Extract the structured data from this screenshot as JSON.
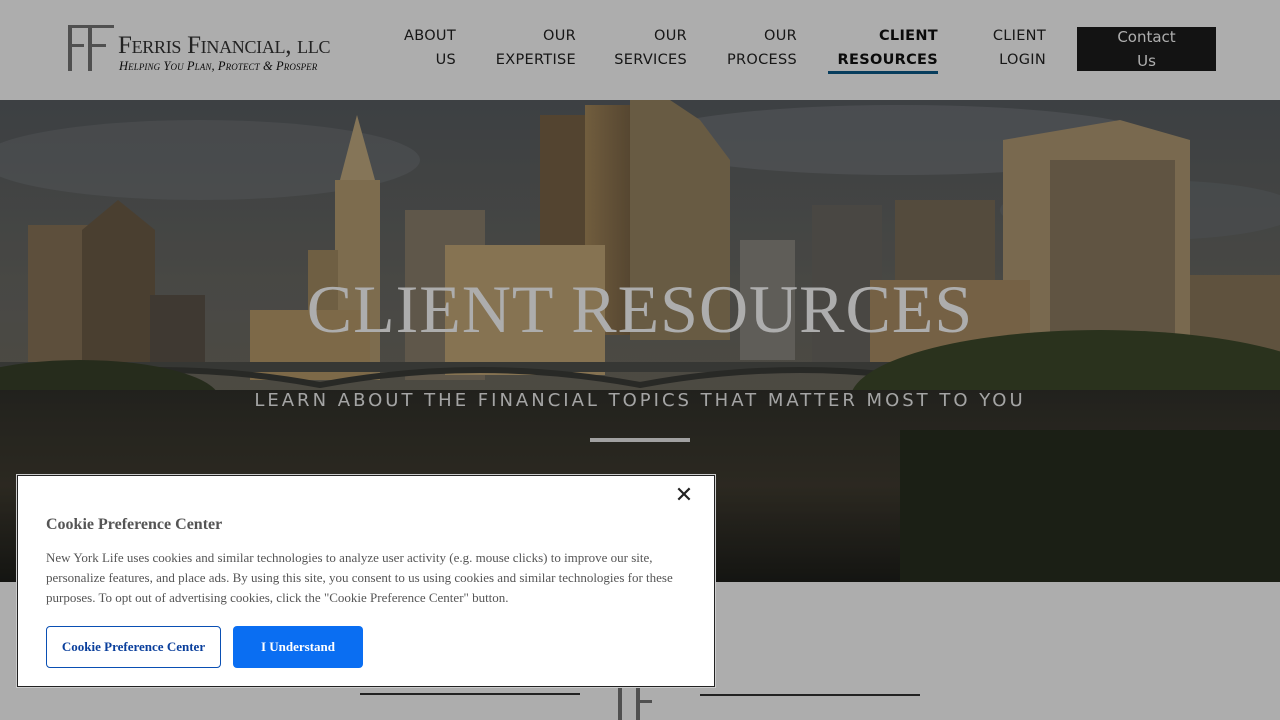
{
  "header": {
    "logo": {
      "mark": "FF",
      "name": "Ferris Financial",
      "suffix": "LLC",
      "tagline": "Helping You Plan, Protect & Prosper"
    },
    "nav": [
      {
        "line1": "ABOUT",
        "line2": "US"
      },
      {
        "line1": "OUR",
        "line2": "EXPERTISE"
      },
      {
        "line1": "OUR",
        "line2": "SERVICES"
      },
      {
        "line1": "OUR",
        "line2": "PROCESS"
      },
      {
        "line1": "CLIENT",
        "line2": "RESOURCES",
        "active": true
      },
      {
        "line1": "CLIENT",
        "line2": "LOGIN"
      }
    ],
    "contact": {
      "line1": "Contact",
      "line2": "Us"
    },
    "active_nav_color": "#0b5a8a"
  },
  "hero": {
    "title": "CLIENT RESOURCES",
    "subtitle": "LEARN ABOUT THE FINANCIAL TOPICS THAT MATTER MOST TO YOU"
  },
  "cookie_dialog": {
    "title": "Cookie Preference Center",
    "body": "New York Life uses cookies and similar technologies to analyze user activity (e.g. mouse clicks) to improve our site, personalize features, and place ads. By using this site, you consent to us using cookies and similar technologies for these purposes. To opt out of advertising cookies, click the \"Cookie Preference Center\" button.",
    "close_icon": "close-icon",
    "preference_button": "Cookie Preference Center",
    "understand_button": "I Understand",
    "primary_color": "#0a6ef2"
  }
}
